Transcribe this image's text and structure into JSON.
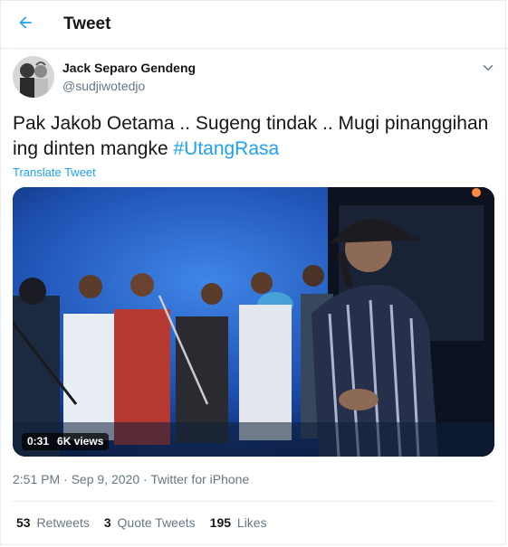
{
  "header": {
    "title": "Tweet",
    "back_icon": "arrow-left-icon",
    "accent": "#1da1f2"
  },
  "author": {
    "display_name": "Jack Separo Gendeng",
    "handle": "@sudjiwotedjo",
    "caret_icon": "chevron-down-icon"
  },
  "tweet": {
    "text": "Pak Jakob Oetama .. Sugeng tindak .. Mugi pinanggihan ing dinten mangke ",
    "hashtag": "#UtangRasa",
    "translate_label": "Translate Tweet"
  },
  "video": {
    "duration": "0:31",
    "views": "6K views"
  },
  "meta": {
    "time": "2:51 PM",
    "separator": "·",
    "date": "Sep 9, 2020",
    "client": "Twitter for iPhone"
  },
  "stats": {
    "retweets_count": "53",
    "retweets_label": "Retweets",
    "quotes_count": "3",
    "quotes_label": "Quote Tweets",
    "likes_count": "195",
    "likes_label": "Likes"
  }
}
